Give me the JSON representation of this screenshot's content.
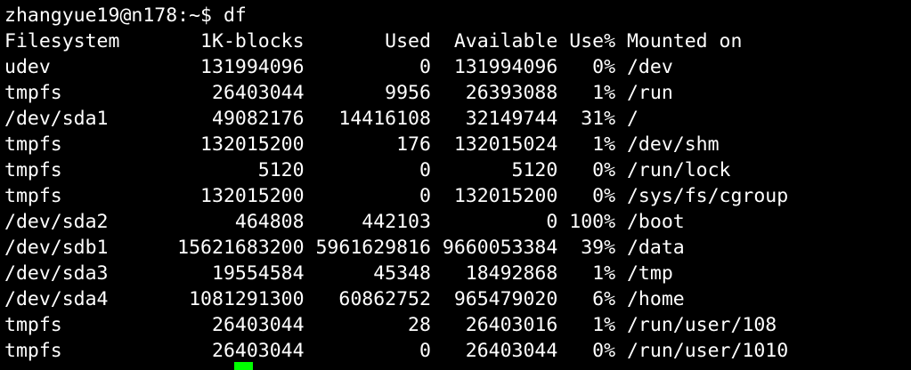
{
  "terminal": {
    "prompt": "zhangyue19@n178:~$ df",
    "lines": [
      "Filesystem       1K-blocks       Used  Available Use% Mounted on",
      "udev             131994096          0  131994096   0% /dev",
      "tmpfs             26403044       9956   26393088   1% /run",
      "/dev/sda1         49082176   14416108   32149744  31% /",
      "tmpfs            132015200        176  132015024   1% /dev/shm",
      "tmpfs                 5120          0       5120   0% /run/lock",
      "tmpfs            132015200          0  132015200   0% /sys/fs/cgroup",
      "/dev/sda2           464808     442103          0 100% /boot",
      "/dev/sdb1      15621683200 5961629816 9660053384  39% /data",
      "/dev/sda3         19554584      45348   18492868   1% /tmp",
      "/dev/sda4       1081291300   60862752  965479020   6% /home",
      "tmpfs             26403044         28   26403016   1% /run/user/108",
      "tmpfs             26403044          0   26403044   0% /run/user/1010"
    ],
    "cursor_color": "#00ff00"
  }
}
